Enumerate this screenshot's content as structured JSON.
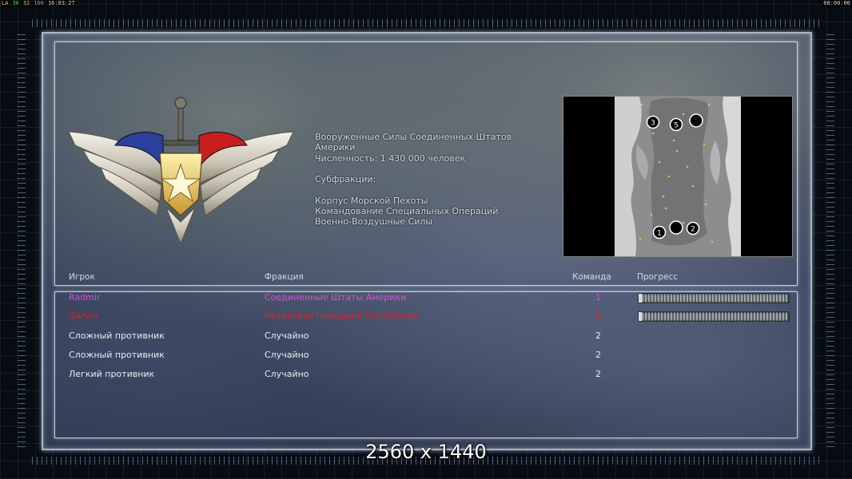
{
  "status_bar": {
    "left": [
      "LA",
      "30",
      "32",
      "100",
      "16:03:27"
    ],
    "right": "00:00:00"
  },
  "faction": {
    "name": "Вооруженные Силы Соединенных Штатов Америки",
    "strength": "Численность: 1 430 000 человек",
    "subfactions_label": "Субфракции:",
    "subfactions": [
      "Корпус Морской Пехоты",
      "Командование Специальных Операций",
      "Военно-Воздушные Силы"
    ]
  },
  "minimap": {
    "start_positions": [
      "3",
      "5",
      "1",
      "2"
    ]
  },
  "table": {
    "headers": {
      "player": "Игрок",
      "faction": "Фракция",
      "team": "Команда",
      "progress": "Прогресс"
    },
    "rows": [
      {
        "player": "Radmir",
        "faction": "Соединенные Штаты Америки",
        "team": "1",
        "color": "#d84ed8",
        "progress": 0.02
      },
      {
        "player": "Garvin",
        "faction": "Китайская Народная Республика",
        "team": "1",
        "color": "#e0202a",
        "progress": 0.02
      },
      {
        "player": "Сложный противник",
        "faction": "Случайно",
        "team": "2",
        "color": "#e8ecf0"
      },
      {
        "player": "Сложный противник",
        "faction": "Случайно",
        "team": "2",
        "color": "#e8ecf0"
      },
      {
        "player": "Легкий противник",
        "faction": "Случайно",
        "team": "2",
        "color": "#e8ecf0"
      }
    ]
  },
  "resolution_caption": "2560 x 1440",
  "colors": {
    "frame": "#aab6c6",
    "player_magenta": "#d84ed8",
    "player_red": "#e0202a"
  }
}
